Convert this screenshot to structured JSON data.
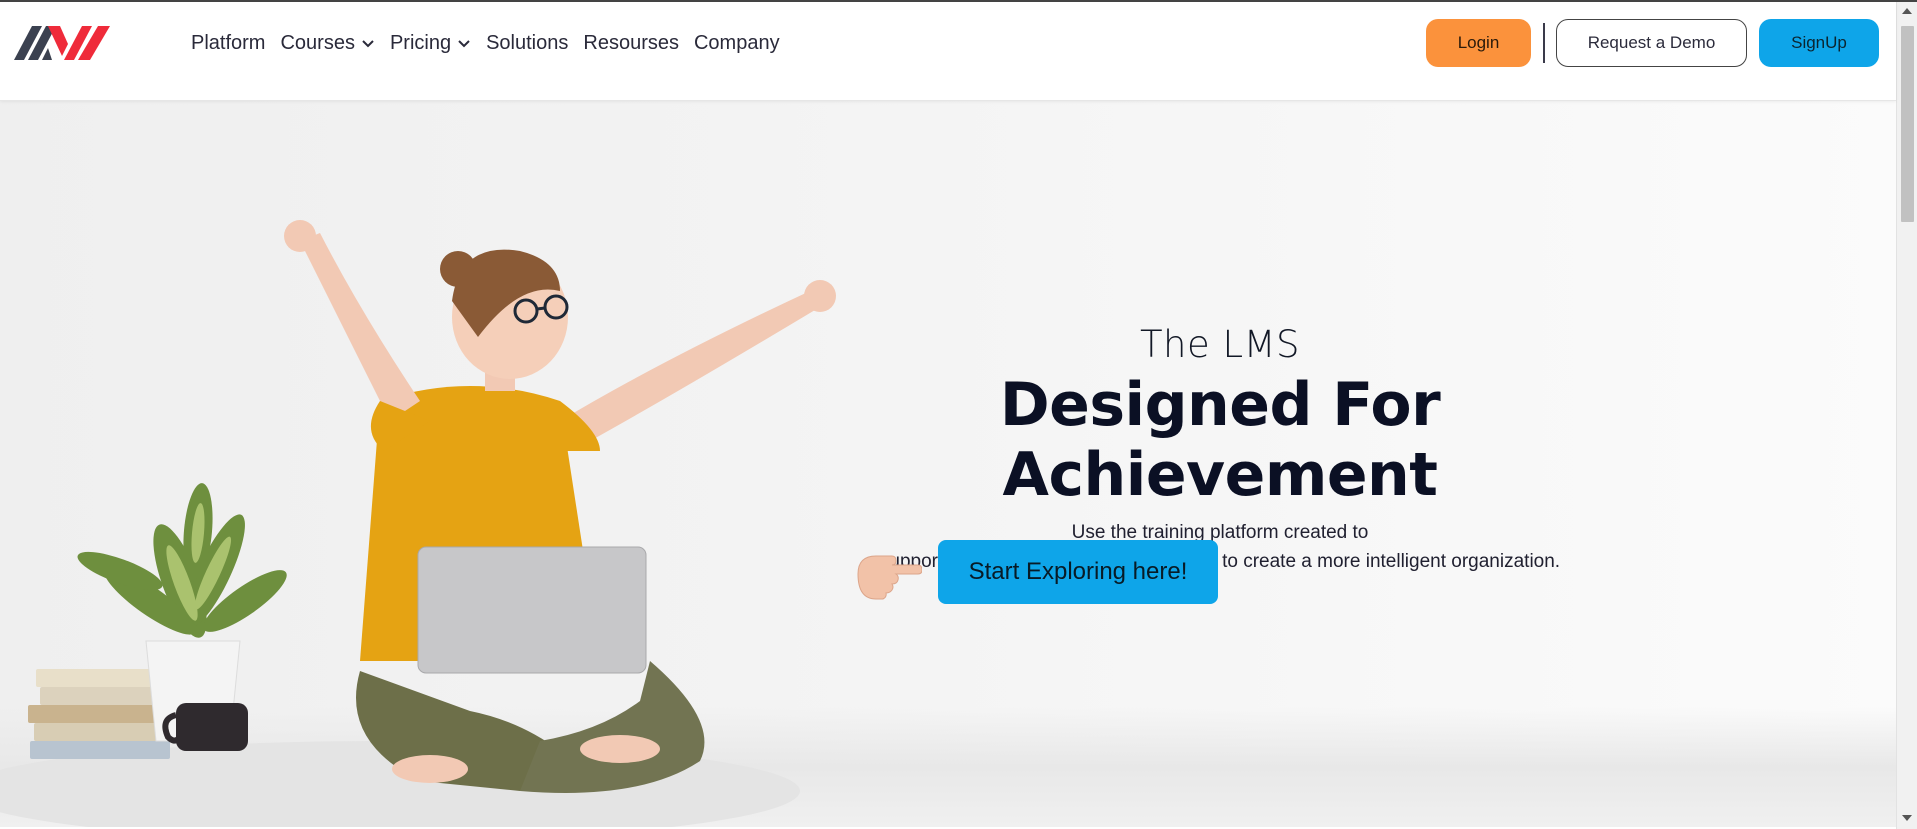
{
  "brand": {
    "logo_icon": "brand-logo-icon",
    "colors": {
      "dark": "#3b4150",
      "red": "#ef2b3a"
    }
  },
  "nav": {
    "items": [
      {
        "label": "Platform",
        "dropdown": false
      },
      {
        "label": "Courses",
        "dropdown": true
      },
      {
        "label": "Pricing",
        "dropdown": true
      },
      {
        "label": "Solutions",
        "dropdown": false
      },
      {
        "label": "Resourses",
        "dropdown": false
      },
      {
        "label": "Company",
        "dropdown": false
      }
    ]
  },
  "header_actions": {
    "login_label": "Login",
    "demo_label": "Request a Demo",
    "signup_label": "SignUp",
    "colors": {
      "login": "#fb923c",
      "signup": "#0ea5e9"
    }
  },
  "hero": {
    "eyebrow": "The LMS",
    "headline": "Designed For Achievement",
    "sub_line1": "Use the training platform created to",
    "sub_line2": "support the growth of exceptional teams to create a more intelligent organization.",
    "cta_label": "Start Exploring here!",
    "cta_icon": "pointing-hand-icon",
    "image": "woman-with-laptop-photo"
  }
}
